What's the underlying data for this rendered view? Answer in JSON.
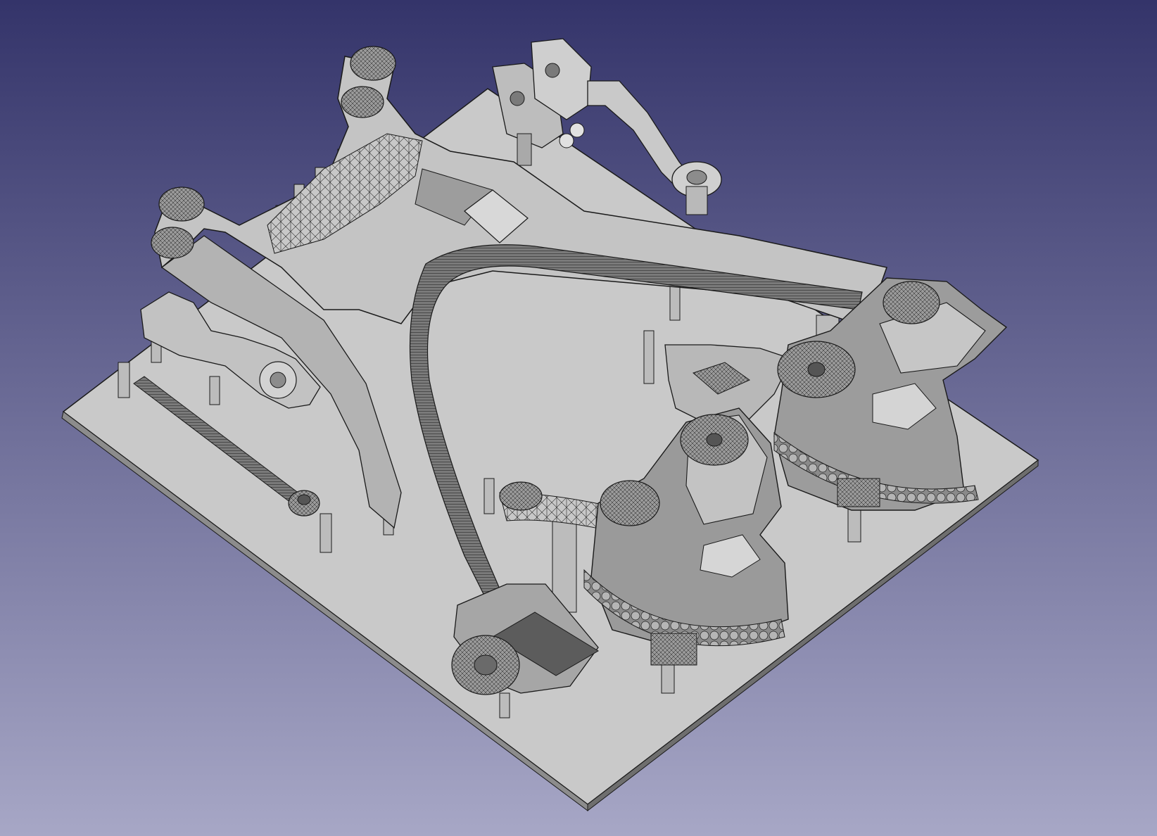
{
  "viewport": {
    "background_top_color": "#34346a",
    "background_bottom_color": "#a7a7c6",
    "model_fill_color": "#c4c4c4",
    "model_shade_color": "#8c8c8c",
    "model_dark_color": "#5a5a5a",
    "edge_color": "#1a1a1a"
  }
}
